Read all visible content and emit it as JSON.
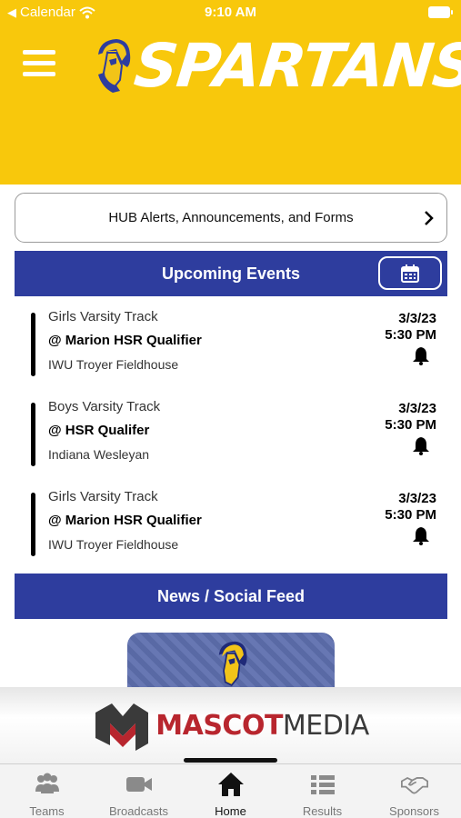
{
  "status_bar": {
    "back_app": "Calendar",
    "time": "9:10 AM"
  },
  "header": {
    "title": "SPARTANS"
  },
  "alerts": {
    "label": "HUB Alerts, Announcements, and Forms"
  },
  "upcoming": {
    "title": "Upcoming Events",
    "events": [
      {
        "sport": "Girls Varsity Track",
        "opponent": "@ Marion HSR Qualifier",
        "venue": "IWU Troyer Fieldhouse",
        "date": "3/3/23",
        "time": "5:30 PM"
      },
      {
        "sport": "Boys Varsity Track",
        "opponent": "@ HSR Qualifer",
        "venue": "Indiana Wesleyan",
        "date": "3/3/23",
        "time": "5:30 PM"
      },
      {
        "sport": "Girls Varsity Track",
        "opponent": "@ Marion HSR Qualifier",
        "venue": "IWU Troyer Fieldhouse",
        "date": "3/3/23",
        "time": "5:30 PM"
      }
    ]
  },
  "news": {
    "title": "News / Social Feed"
  },
  "sponsor": {
    "name_part1": "MASCOT",
    "name_part2": "MEDIA"
  },
  "tabs": [
    {
      "label": "Teams",
      "icon": "people-icon"
    },
    {
      "label": "Broadcasts",
      "icon": "video-camera-icon"
    },
    {
      "label": "Home",
      "icon": "house-icon",
      "active": true
    },
    {
      "label": "Results",
      "icon": "list-icon"
    },
    {
      "label": "Sponsors",
      "icon": "handshake-icon"
    }
  ],
  "colors": {
    "brand_yellow": "#f8c80c",
    "brand_blue": "#2e3d9e",
    "sponsor_red": "#b8262e"
  }
}
